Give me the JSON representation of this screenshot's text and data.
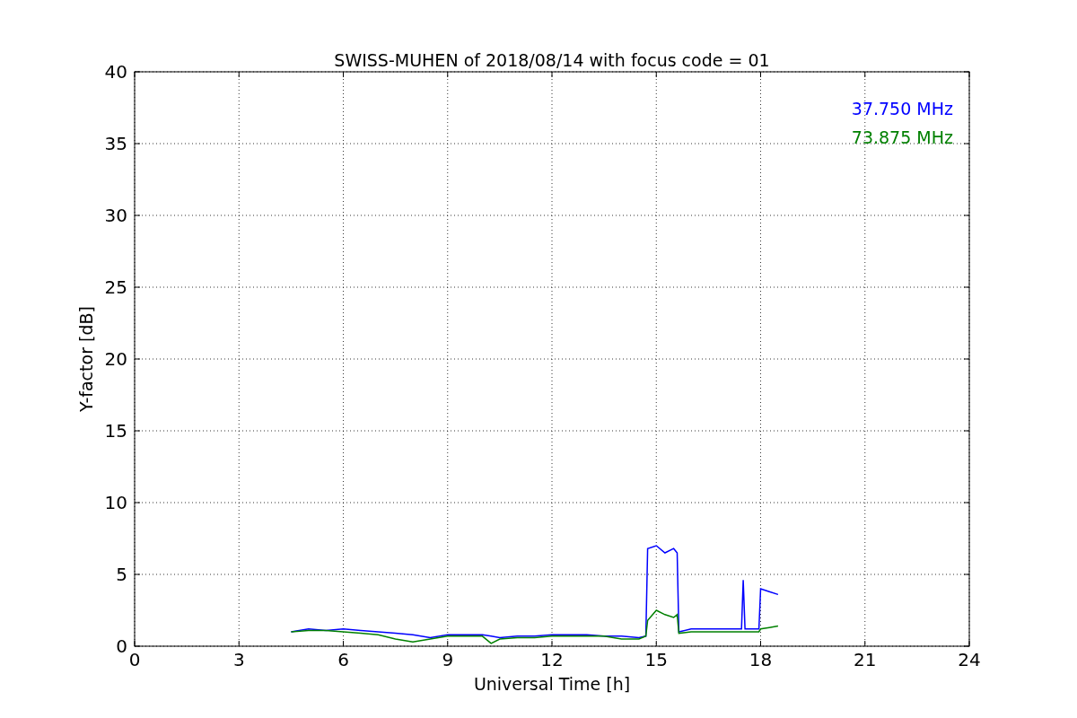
{
  "chart_data": {
    "type": "line",
    "title": "SWISS-MUHEN of 2018/08/14 with focus code = 01",
    "xlabel": "Universal Time [h]",
    "ylabel": "Y-factor [dB]",
    "x": [
      4.5,
      5,
      5.5,
      6,
      6.5,
      7,
      7.5,
      8,
      8.5,
      9,
      9.5,
      10,
      10.25,
      10.5,
      11,
      11.5,
      12,
      12.5,
      13,
      13.5,
      14,
      14.5,
      14.7,
      14.75,
      15,
      15.25,
      15.5,
      15.6,
      15.65,
      16,
      16.5,
      17,
      17.45,
      17.5,
      17.55,
      17.95,
      18,
      18.25,
      18.5
    ],
    "series": [
      {
        "name": "37.750 MHz",
        "color": "#0000ff",
        "values": [
          1.0,
          1.2,
          1.1,
          1.2,
          1.1,
          1.0,
          0.9,
          0.8,
          0.6,
          0.8,
          0.8,
          0.8,
          0.7,
          0.6,
          0.7,
          0.7,
          0.8,
          0.8,
          0.8,
          0.7,
          0.7,
          0.6,
          0.7,
          6.8,
          7.0,
          6.5,
          6.8,
          6.5,
          1.0,
          1.2,
          1.2,
          1.2,
          1.2,
          4.6,
          1.2,
          1.2,
          4.0,
          3.8,
          3.6
        ]
      },
      {
        "name": "73.875 MHz",
        "color": "#008000",
        "values": [
          1.0,
          1.1,
          1.1,
          1.0,
          0.9,
          0.8,
          0.5,
          0.3,
          0.5,
          0.7,
          0.7,
          0.7,
          0.2,
          0.5,
          0.6,
          0.6,
          0.7,
          0.7,
          0.7,
          0.7,
          0.5,
          0.5,
          0.7,
          1.8,
          2.5,
          2.2,
          2.0,
          2.2,
          0.9,
          1.0,
          1.0,
          1.0,
          1.0,
          1.0,
          1.0,
          1.0,
          1.2,
          1.3,
          1.4
        ]
      }
    ],
    "xlim": [
      0,
      24
    ],
    "ylim": [
      0,
      40
    ],
    "xticks": [
      0,
      3,
      6,
      9,
      12,
      15,
      18,
      21,
      24
    ],
    "yticks": [
      0,
      5,
      10,
      15,
      20,
      25,
      30,
      35,
      40
    ],
    "grid": true
  }
}
